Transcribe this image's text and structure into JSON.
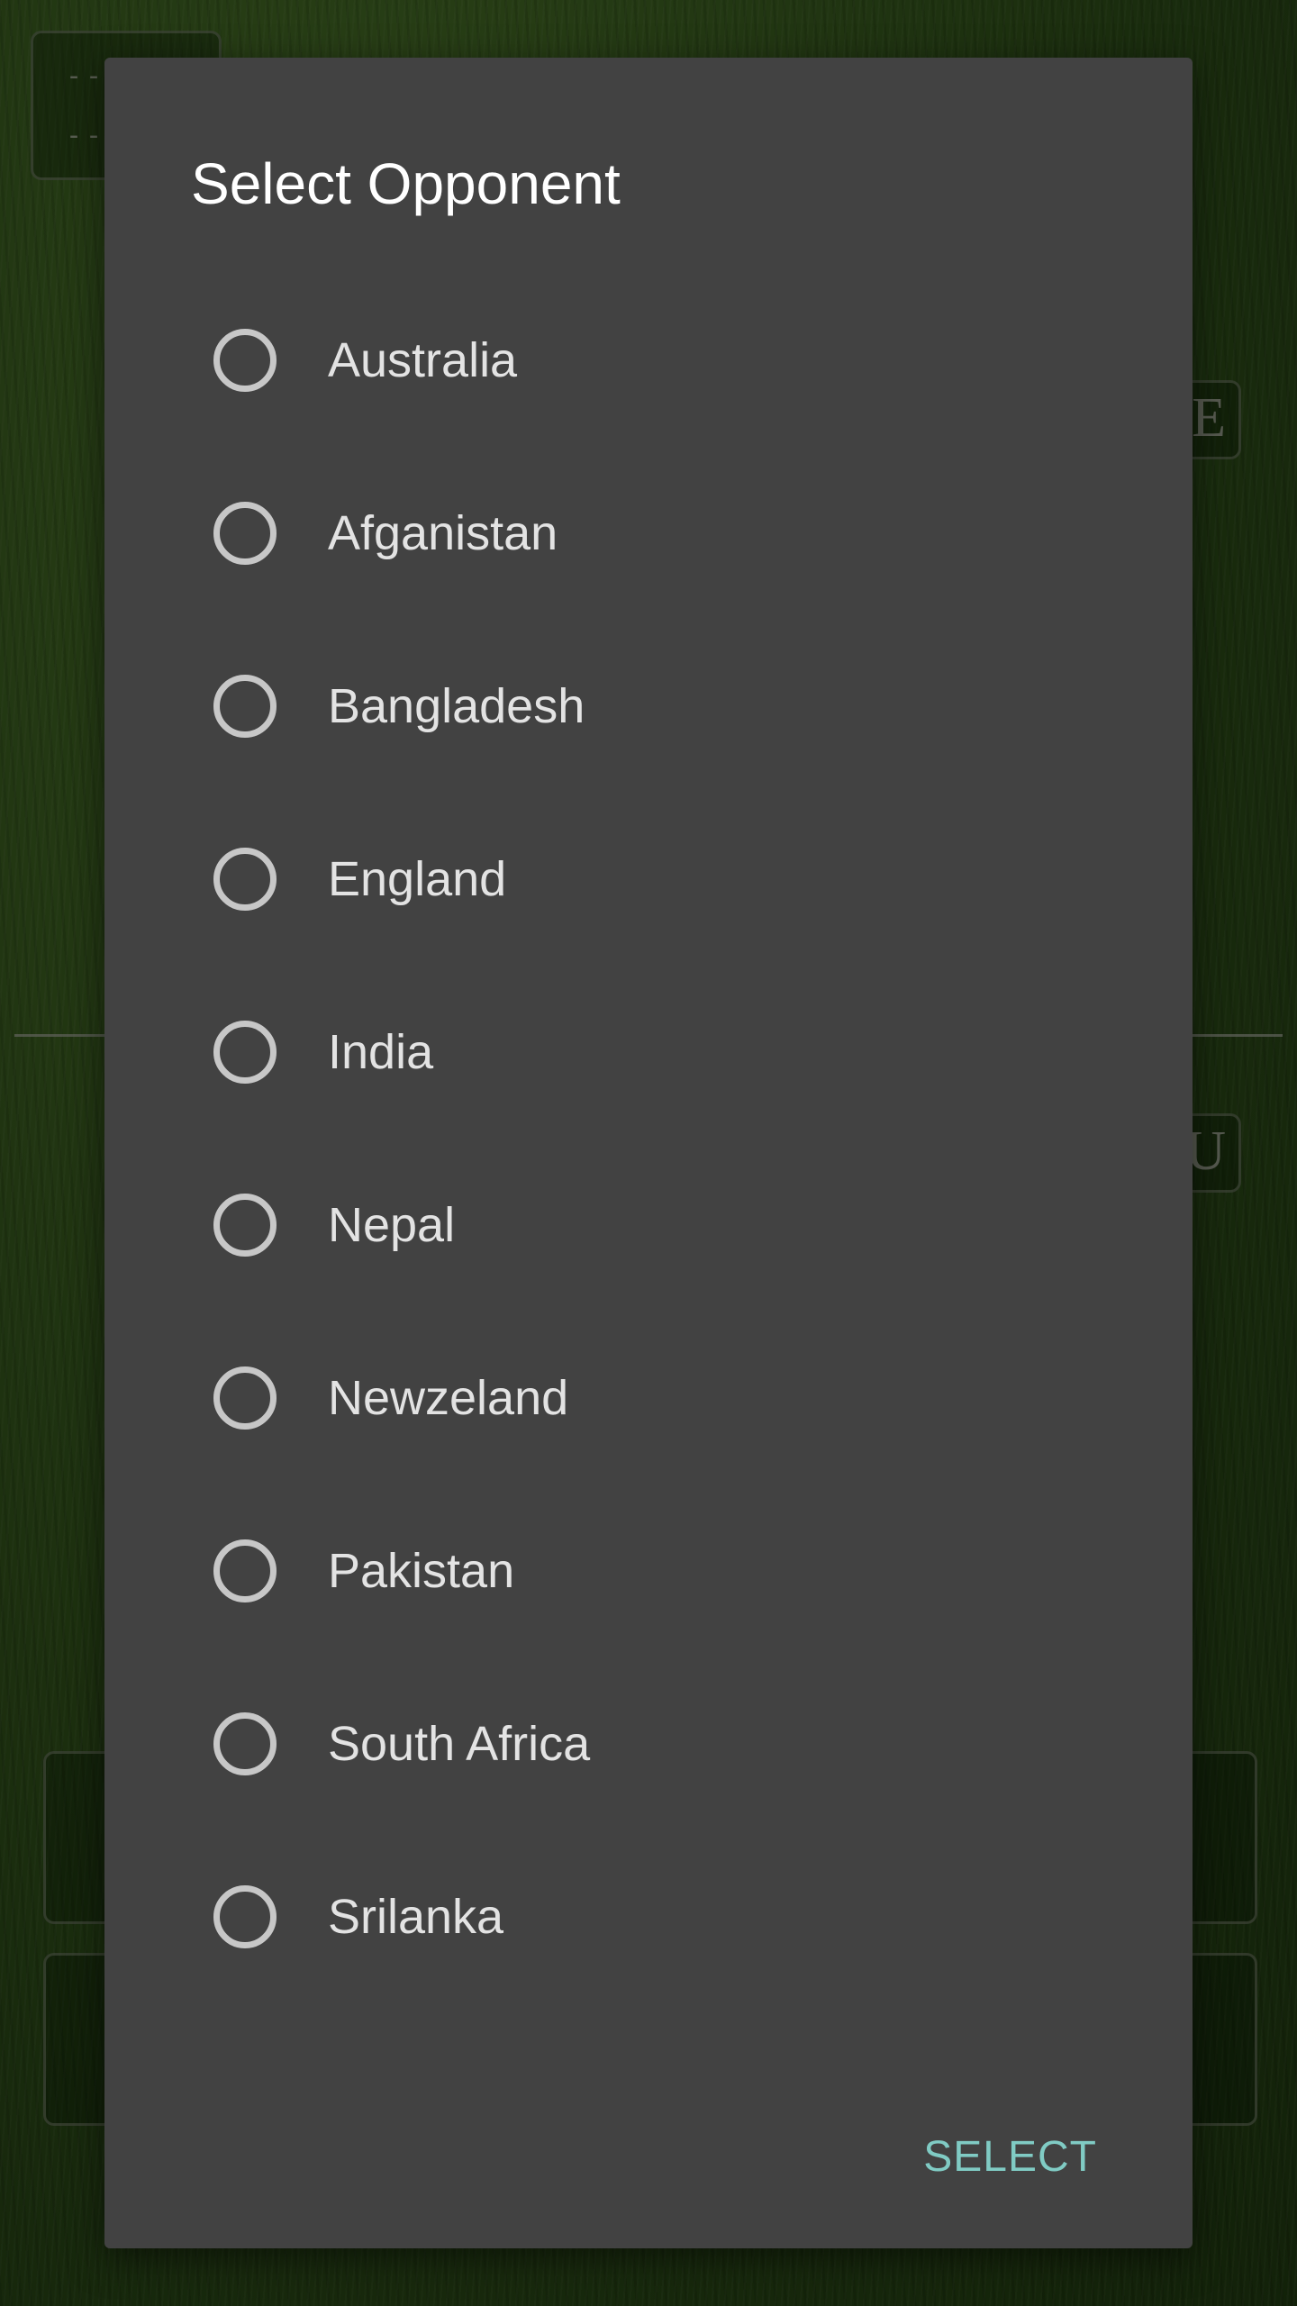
{
  "background": {
    "top_left_box_text": [
      "-- :",
      "-- :"
    ],
    "right_box_letters": [
      "E",
      "U"
    ]
  },
  "dialog": {
    "title": "Select Opponent",
    "options": [
      {
        "label": "Australia",
        "selected": false
      },
      {
        "label": "Afganistan",
        "selected": false
      },
      {
        "label": "Bangladesh",
        "selected": false
      },
      {
        "label": "England",
        "selected": false
      },
      {
        "label": "India",
        "selected": false
      },
      {
        "label": "Nepal",
        "selected": false
      },
      {
        "label": "Newzeland",
        "selected": false
      },
      {
        "label": "Pakistan",
        "selected": false
      },
      {
        "label": "South Africa",
        "selected": false
      },
      {
        "label": "Srilanka",
        "selected": false
      }
    ],
    "select_label": "SELECT"
  },
  "colors": {
    "dialog_background": "#424242",
    "accent": "#80cbc4",
    "radio_ring": "#c7c7c7",
    "scrim": "rgba(0,0,0,0.45)"
  }
}
